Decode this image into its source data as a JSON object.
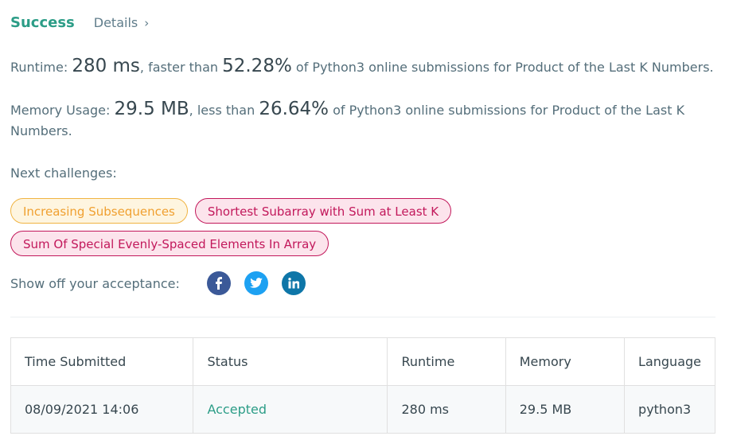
{
  "header": {
    "status": "Success",
    "details_label": "Details",
    "details_chevron": "›"
  },
  "runtime": {
    "label": "Runtime:",
    "value": "280 ms",
    "mid_text": ", faster than",
    "percent": "52.28%",
    "tail_text": "of Python3 online submissions for Product of the Last K Numbers."
  },
  "memory": {
    "label": "Memory Usage:",
    "value": "29.5 MB",
    "mid_text": ", less than",
    "percent": "26.64%",
    "tail_text": "of Python3 online submissions for Product of the Last K Numbers."
  },
  "next_challenges": {
    "label": "Next challenges:",
    "items": [
      {
        "title": "Increasing Subsequences",
        "difficulty": "medium"
      },
      {
        "title": "Shortest Subarray with Sum at Least K",
        "difficulty": "hard"
      },
      {
        "title": "Sum Of Special Evenly-Spaced Elements In Array",
        "difficulty": "hard"
      }
    ]
  },
  "share": {
    "label": "Show off your acceptance:",
    "icons": [
      "facebook-icon",
      "twitter-icon",
      "linkedin-icon"
    ]
  },
  "colors": {
    "success": "#2c9d87",
    "medium": "#f0a030",
    "hard": "#c2185b",
    "facebook": "#3b5998",
    "twitter": "#1da1f2",
    "linkedin": "#0e76a8"
  },
  "submissions": {
    "columns": [
      "Time Submitted",
      "Status",
      "Runtime",
      "Memory",
      "Language"
    ],
    "rows": [
      {
        "time": "08/09/2021 14:06",
        "status": "Accepted",
        "runtime": "280 ms",
        "memory": "29.5 MB",
        "language": "python3"
      }
    ]
  }
}
